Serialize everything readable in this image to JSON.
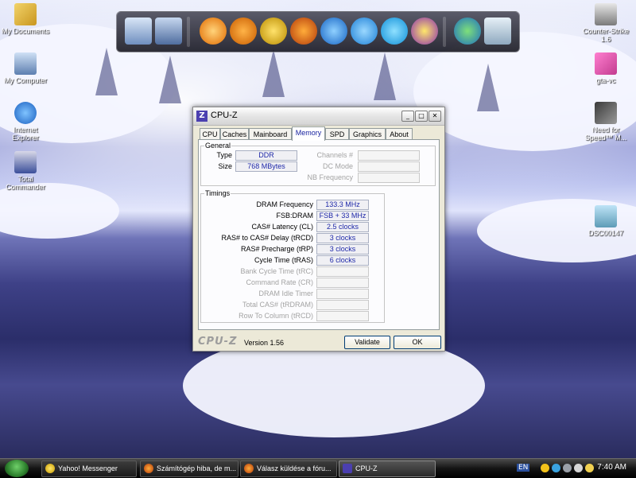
{
  "desktop": {
    "icons_left": [
      {
        "label": "My Documents",
        "icon": "folder-documents-icon"
      },
      {
        "label": "My Computer",
        "icon": "my-computer-icon"
      },
      {
        "label": "Internet Explorer",
        "icon": "internet-explorer-icon"
      },
      {
        "label": "Total Commander",
        "icon": "floppy-disk-icon"
      }
    ],
    "icons_right": [
      {
        "label": "Counter-Strike 1.6",
        "icon": "counter-strike-icon"
      },
      {
        "label": "gta-vc",
        "icon": "gta-icon"
      },
      {
        "label": "Need for Speed™ M...",
        "icon": "need-for-speed-icon"
      },
      {
        "label": "DSC00147",
        "icon": "image-file-icon"
      }
    ]
  },
  "dock": {
    "items": [
      "monitor-icon",
      "network-icon",
      "media-player-icon",
      "vlc-icon",
      "winamp-icon",
      "firefox-icon",
      "internet-explorer-icon",
      "play-icon",
      "skype-icon",
      "yahoo-messenger-icon",
      "windows-icon",
      "recycle-bin-icon"
    ]
  },
  "window": {
    "title": "CPU-Z",
    "icon_letter": "Z",
    "minimize": "_",
    "maximize": "□",
    "close": "✕",
    "tabs": [
      "CPU",
      "Caches",
      "Mainboard",
      "Memory",
      "SPD",
      "Graphics",
      "About"
    ],
    "active_tab": "Memory",
    "general": {
      "legend": "General",
      "type_label": "Type",
      "type_value": "DDR",
      "size_label": "Size",
      "size_value": "768 MBytes",
      "channels_label": "Channels #",
      "channels_value": "",
      "dc_mode_label": "DC Mode",
      "dc_mode_value": "",
      "nb_freq_label": "NB Frequency",
      "nb_freq_value": ""
    },
    "timings": {
      "legend": "Timings",
      "rows": [
        {
          "label": "DRAM Frequency",
          "value": "133.3 MHz",
          "enabled": true
        },
        {
          "label": "FSB:DRAM",
          "value": "FSB + 33 MHz",
          "enabled": true
        },
        {
          "label": "CAS# Latency (CL)",
          "value": "2.5 clocks",
          "enabled": true
        },
        {
          "label": "RAS# to CAS# Delay (tRCD)",
          "value": "3 clocks",
          "enabled": true
        },
        {
          "label": "RAS# Precharge (tRP)",
          "value": "3 clocks",
          "enabled": true
        },
        {
          "label": "Cycle Time (tRAS)",
          "value": "6 clocks",
          "enabled": true
        },
        {
          "label": "Bank Cycle Time (tRC)",
          "value": "",
          "enabled": false
        },
        {
          "label": "Command Rate (CR)",
          "value": "",
          "enabled": false
        },
        {
          "label": "DRAM Idle Timer",
          "value": "",
          "enabled": false
        },
        {
          "label": "Total CAS# (tRDRAM)",
          "value": "",
          "enabled": false
        },
        {
          "label": "Row To Column (tRCD)",
          "value": "",
          "enabled": false
        }
      ]
    },
    "footer": {
      "logo": "CPU-Z",
      "version": "Version 1.56",
      "validate_label": "Validate",
      "ok_label": "OK"
    }
  },
  "taskbar": {
    "tasks": [
      {
        "label": "Yahoo! Messenger",
        "icon": "yahoo-messenger-icon"
      },
      {
        "label": "Számítógép hiba, de m...",
        "icon": "firefox-icon"
      },
      {
        "label": "Válasz küldése a fóru...",
        "icon": "firefox-icon"
      },
      {
        "label": "CPU-Z",
        "icon": "cpu-z-icon",
        "active": true
      }
    ],
    "language": "EN",
    "clock": "7:40 AM"
  },
  "colors": {
    "value_text": "#1e28a8",
    "active_tab_text": "#1a24a0",
    "window_bg": "#ece9d8"
  }
}
